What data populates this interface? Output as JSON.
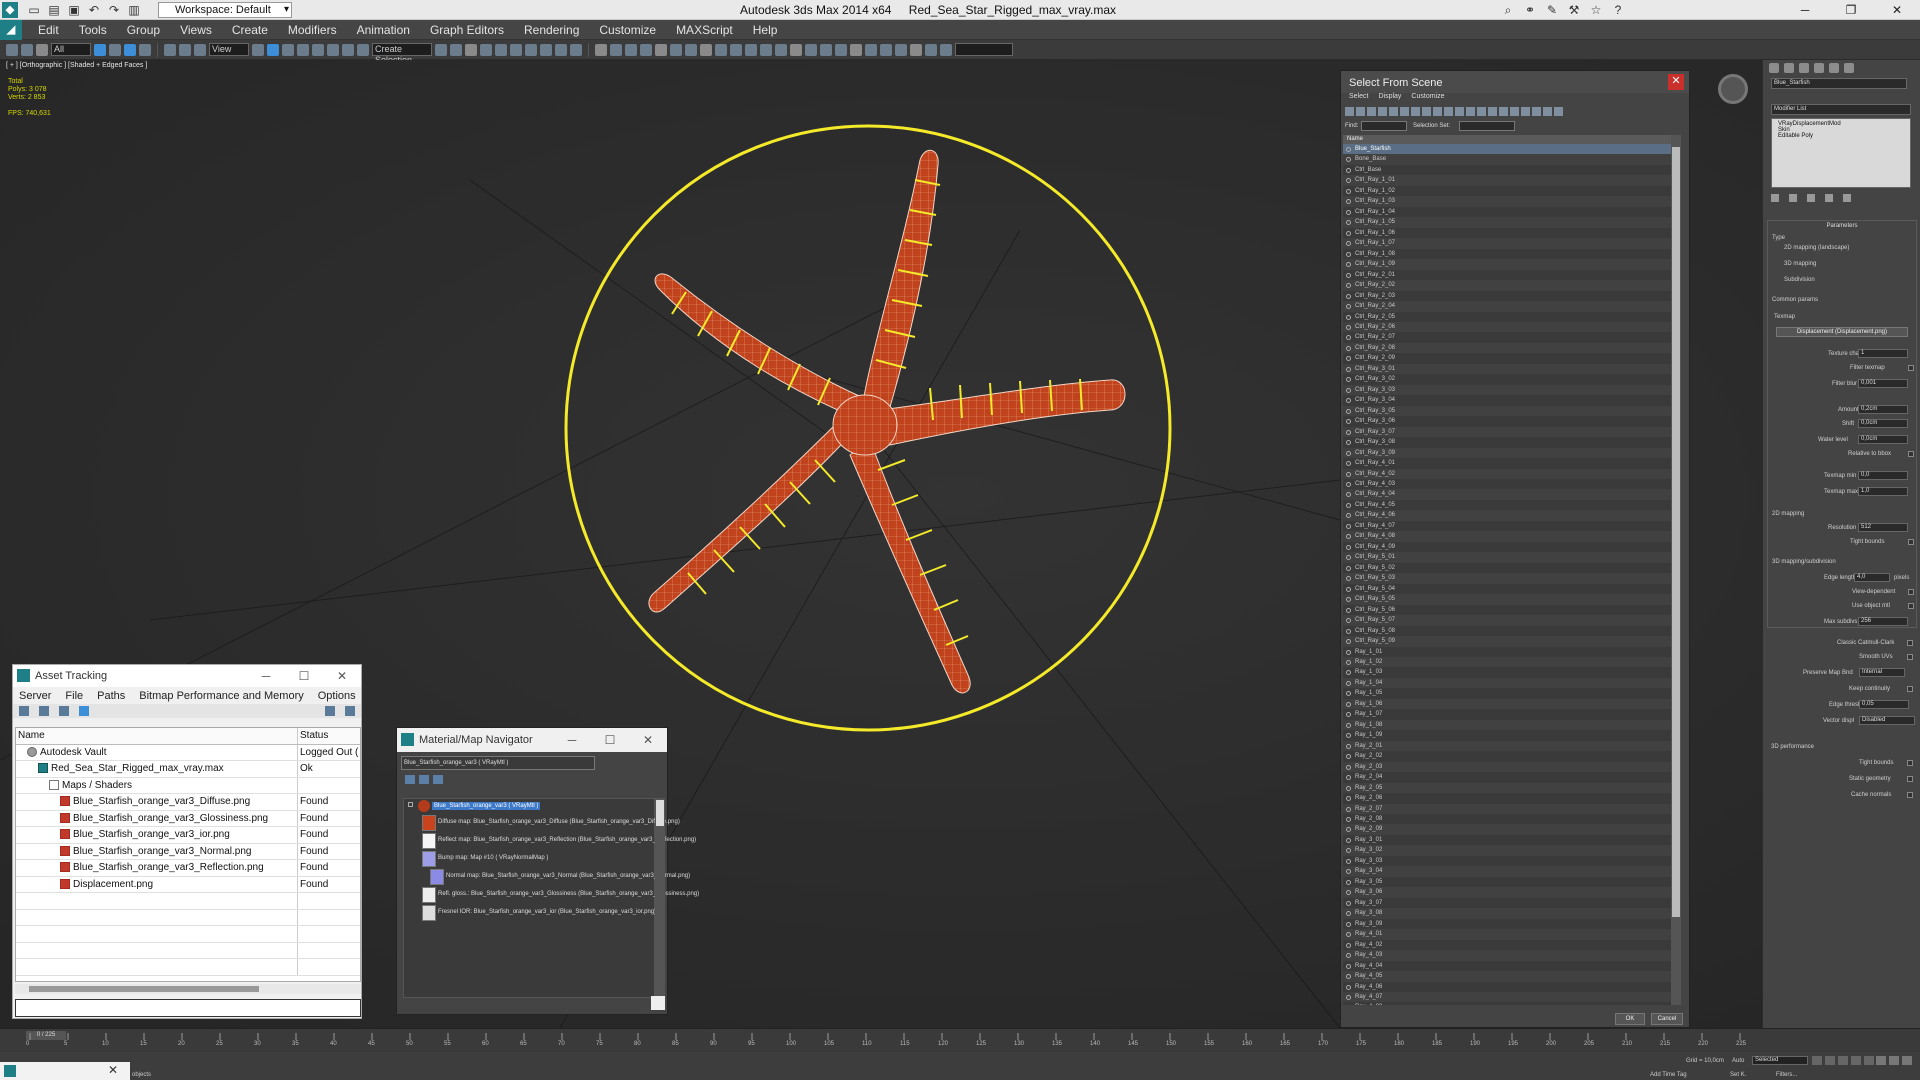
{
  "titlebar": {
    "workspace": "Workspace: Default",
    "app_title": "Autodesk 3ds Max  2014 x64",
    "file_title": "Red_Sea_Star_Rigged_max_vray.max"
  },
  "menu": [
    "Edit",
    "Tools",
    "Group",
    "Views",
    "Create",
    "Modifiers",
    "Animation",
    "Graph Editors",
    "Rendering",
    "Customize",
    "MAXScript",
    "Help"
  ],
  "toolbar": {
    "filter": "All",
    "view": "View",
    "selset": "Create Selection"
  },
  "viewport": {
    "label": "[ + ] [Orthographic ] [Shaded + Edged Faces ]",
    "stats": {
      "total": "Total",
      "polys": "Polys:  3 078",
      "verts": "Verts:  2 853",
      "fps": "FPS:       740,631"
    }
  },
  "select_from_scene": {
    "title": "Select From Scene",
    "menu": [
      "Select",
      "Display",
      "Customize"
    ],
    "find_label": "Find:",
    "selection_set_label": "Selection Set:",
    "column_name": "Name",
    "items": [
      "Blue_Starfish",
      "Bone_Base",
      "Ctrl_Base",
      "Ctrl_Ray_1_01",
      "Ctrl_Ray_1_02",
      "Ctrl_Ray_1_03",
      "Ctrl_Ray_1_04",
      "Ctrl_Ray_1_05",
      "Ctrl_Ray_1_06",
      "Ctrl_Ray_1_07",
      "Ctrl_Ray_1_08",
      "Ctrl_Ray_1_09",
      "Ctrl_Ray_2_01",
      "Ctrl_Ray_2_02",
      "Ctrl_Ray_2_03",
      "Ctrl_Ray_2_04",
      "Ctrl_Ray_2_05",
      "Ctrl_Ray_2_06",
      "Ctrl_Ray_2_07",
      "Ctrl_Ray_2_08",
      "Ctrl_Ray_2_09",
      "Ctrl_Ray_3_01",
      "Ctrl_Ray_3_02",
      "Ctrl_Ray_3_03",
      "Ctrl_Ray_3_04",
      "Ctrl_Ray_3_05",
      "Ctrl_Ray_3_06",
      "Ctrl_Ray_3_07",
      "Ctrl_Ray_3_08",
      "Ctrl_Ray_3_09",
      "Ctrl_Ray_4_01",
      "Ctrl_Ray_4_02",
      "Ctrl_Ray_4_03",
      "Ctrl_Ray_4_04",
      "Ctrl_Ray_4_05",
      "Ctrl_Ray_4_06",
      "Ctrl_Ray_4_07",
      "Ctrl_Ray_4_08",
      "Ctrl_Ray_4_09",
      "Ctrl_Ray_5_01",
      "Ctrl_Ray_5_02",
      "Ctrl_Ray_5_03",
      "Ctrl_Ray_5_04",
      "Ctrl_Ray_5_05",
      "Ctrl_Ray_5_06",
      "Ctrl_Ray_5_07",
      "Ctrl_Ray_5_08",
      "Ctrl_Ray_5_09",
      "Ray_1_01",
      "Ray_1_02",
      "Ray_1_03",
      "Ray_1_04",
      "Ray_1_05",
      "Ray_1_06",
      "Ray_1_07",
      "Ray_1_08",
      "Ray_1_09",
      "Ray_2_01",
      "Ray_2_02",
      "Ray_2_03",
      "Ray_2_04",
      "Ray_2_05",
      "Ray_2_06",
      "Ray_2_07",
      "Ray_2_08",
      "Ray_2_09",
      "Ray_3_01",
      "Ray_3_02",
      "Ray_3_03",
      "Ray_3_04",
      "Ray_3_05",
      "Ray_3_06",
      "Ray_3_07",
      "Ray_3_08",
      "Ray_3_09",
      "Ray_4_01",
      "Ray_4_02",
      "Ray_4_03",
      "Ray_4_04",
      "Ray_4_05",
      "Ray_4_06",
      "Ray_4_07",
      "Ray_4_08"
    ],
    "ok": "OK",
    "cancel": "Cancel"
  },
  "command_panel": {
    "object_name": "Blue_Starfish",
    "modifier_list": "Modifier List",
    "stack": [
      "VRayDisplacementMod",
      "Skin",
      "Editable Poly"
    ],
    "params_title": "Parameters",
    "type_label": "Type",
    "type_options": [
      "2D mapping (landscape)",
      "3D mapping",
      "Subdivision"
    ],
    "common_label": "Common params",
    "texmap_label": "Texmap",
    "texmap_value": "Displacement (Displacement.png)",
    "texture_chan": "Texture chan",
    "texture_chan_val": "1",
    "filter_texmap": "Filter texmap",
    "filter_blur": "Filter blur",
    "filter_blur_val": "0,001",
    "amount": "Amount",
    "amount_val": "0,2cm",
    "shift": "Shift",
    "shift_val": "0,0cm",
    "water_level": "Water level",
    "water_level_val": "0,0cm",
    "relative_bbox": "Relative to bbox",
    "texmap_min": "Texmap min",
    "texmap_min_val": "0,0",
    "texmap_max": "Texmap max",
    "texmap_max_val": "1,0",
    "mapping2d_title": "2D mapping",
    "resolution": "Resolution",
    "resolution_val": "512",
    "tight_bounds": "Tight bounds",
    "mapping3d_title": "3D mapping/subdivision",
    "edge_length": "Edge length",
    "edge_length_val": "4,0",
    "pixels": "pixels",
    "view_dependent": "View-dependent",
    "use_object_mtl": "Use object mtl",
    "max_subdivs": "Max subdivs",
    "max_subdivs_val": "256",
    "classic_cc": "Classic Catmull-Clark",
    "smooth_uv": "Smooth UVs",
    "preserve_map_bnd": "Preserve Map Bnd",
    "preserve_map_bnd_val": "Internal",
    "keep_continuity": "Keep continuity",
    "edge_thresh": "Edge thresh",
    "edge_thresh_val": "0,05",
    "vector_displ": "Vector displ",
    "vector_displ_val": "Disabled",
    "performance_title": "3D performance",
    "static_geometry": "Static geometry",
    "cache_normals": "Cache normals"
  },
  "asset_tracking": {
    "title": "Asset Tracking",
    "menu": [
      "Server",
      "File",
      "Paths",
      "Bitmap Performance and Memory",
      "Options"
    ],
    "col_name": "Name",
    "col_status": "Status",
    "rows": [
      {
        "name": "Autodesk Vault",
        "status": "Logged Out (",
        "icon": "vault",
        "indent": 1
      },
      {
        "name": "Red_Sea_Star_Rigged_max_vray.max",
        "status": "Ok",
        "icon": "max",
        "indent": 2
      },
      {
        "name": "Maps / Shaders",
        "status": "",
        "icon": "folder",
        "indent": 3
      },
      {
        "name": "Blue_Starfish_orange_var3_Diffuse.png",
        "status": "Found",
        "icon": "img",
        "indent": 4
      },
      {
        "name": "Blue_Starfish_orange_var3_Glossiness.png",
        "status": "Found",
        "icon": "img",
        "indent": 4
      },
      {
        "name": "Blue_Starfish_orange_var3_ior.png",
        "status": "Found",
        "icon": "img",
        "indent": 4
      },
      {
        "name": "Blue_Starfish_orange_var3_Normal.png",
        "status": "Found",
        "icon": "img",
        "indent": 4
      },
      {
        "name": "Blue_Starfish_orange_var3_Reflection.png",
        "status": "Found",
        "icon": "img",
        "indent": 4
      },
      {
        "name": "Displacement.png",
        "status": "Found",
        "icon": "img",
        "indent": 4
      }
    ]
  },
  "material_navigator": {
    "title": "Material/Map Navigator",
    "name_field": "Blue_Starfish_orange_var3  ( VRayMtl )",
    "root": "Blue_Starfish_orange_var3  ( VRayMtl )",
    "nodes": [
      "Diffuse map: Blue_Starfish_orange_var3_Diffuse (Blue_Starfish_orange_var3_Diffuse.png)",
      "Reflect map: Blue_Starfish_orange_var3_Reflection (Blue_Starfish_orange_var3_Reflection.png)",
      "Bump map: Map #10  ( VRayNormalMap )",
      "Normal map: Blue_Starfish_orange_var3_Normal (Blue_Starfish_orange_var3_Normal.png)",
      "Refl. gloss.: Blue_Starfish_orange_var3_Glossiness (Blue_Starfish_orange_var3_Glossiness.png)",
      "Fresnel IOR: Blue_Starfish_orange_var3_ior (Blue_Starfish_orange_var3_ior.png)"
    ]
  },
  "timeline": {
    "frame": "0 / 225",
    "ticks": [
      "0",
      "5",
      "10",
      "15",
      "20",
      "25",
      "30",
      "35",
      "40",
      "45",
      "50",
      "55",
      "60",
      "65",
      "70",
      "75",
      "80",
      "85",
      "90",
      "95",
      "100",
      "105",
      "110",
      "115",
      "120",
      "125",
      "130",
      "135",
      "140",
      "145",
      "150",
      "155",
      "160",
      "165",
      "170",
      "175",
      "180",
      "185",
      "190",
      "195",
      "200",
      "205",
      "210",
      "215",
      "220",
      "225"
    ]
  },
  "status": {
    "objects": "objects",
    "grid": "Grid = 10,0cm",
    "add_time_tag": "Add Time Tag",
    "auto": "Auto",
    "set_k": "Set K.",
    "selected": "Selected",
    "filters": "Filters..."
  }
}
